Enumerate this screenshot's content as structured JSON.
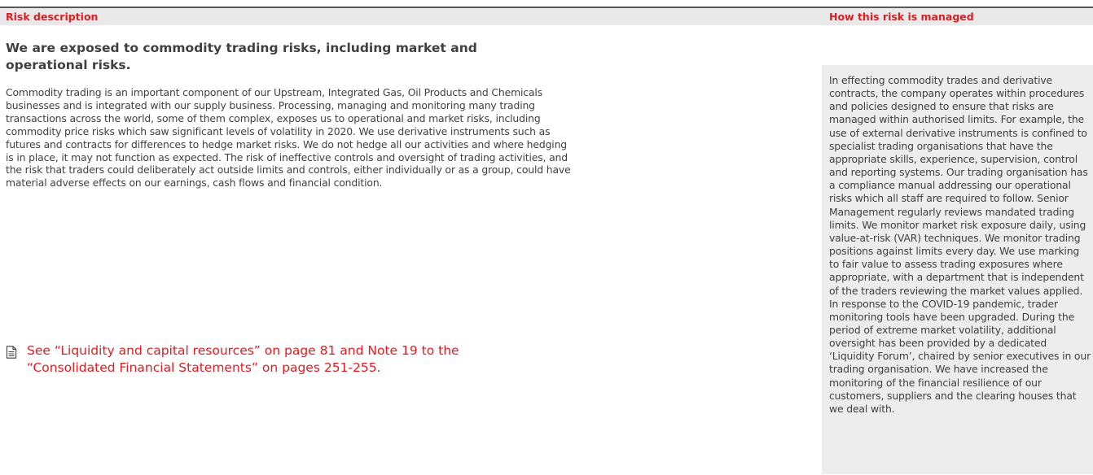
{
  "header": {
    "risk_description": "Risk description",
    "how_managed": "How this risk is managed"
  },
  "risk": {
    "title": "We are exposed to commodity trading risks, including market and operational risks.",
    "body": "Commodity trading is an important component of our Upstream, Integrated Gas, Oil Products and Chemicals businesses and is integrated with our supply business. Processing, managing and monitoring many trading transactions across the world, some of them complex, exposes us to operational and market risks, including commodity price risks which saw significant levels of volatility in 2020. We use derivative instruments such as futures and contracts for differences to hedge market risks. We do not hedge all our activities and where hedging is in place, it may not function as expected. The risk of ineffective controls and oversight of trading activities, and the risk that traders could deliberately act outside limits and controls, either individually or as a group, could have material adverse effects on our earnings, cash flows and financial condition.",
    "see_reference": "See “Liquidity and capital resources” on page 81 and Note 19 to the “Consolidated Financial Statements” on pages 251-255."
  },
  "managed": {
    "text": "In effecting commodity trades and derivative contracts, the company operates within procedures and policies designed to ensure that risks are managed within authorised limits. For example, the use of external derivative instruments is confined to specialist trading organisations that have the appropriate skills, experience, supervision, control and reporting systems. Our trading organisation has a compliance manual addressing our operational risks which all staff are required to follow. Senior Management regularly reviews mandated trading limits. We monitor market risk exposure daily, using value-at-risk (VAR) techniques. We monitor trading positions against limits every day. We use marking to fair value to assess trading exposures where appropriate, with a department that is independent of the traders reviewing the market values applied. In response to the COVID-19 pandemic, trader monitoring tools have been upgraded. During the period of extreme market volatility, additional oversight has been provided by a dedicated ‘Liquidity Forum’, chaired by senior executives in our trading organisation. We have increased the monitoring of the financial resilience of our customers, suppliers and the clearing houses that we deal with."
  },
  "icons": {
    "reference": "document-icon"
  },
  "colors": {
    "accent_red": "#dd1d21",
    "body_text": "#404040",
    "header_bg": "#e9e9e9",
    "panel_bg": "#ededed"
  }
}
